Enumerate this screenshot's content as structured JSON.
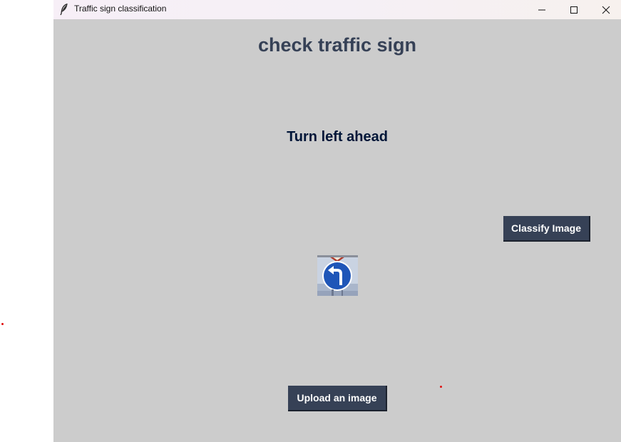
{
  "window": {
    "title": "Traffic sign classification",
    "icon": "feather-icon"
  },
  "titlebar_controls": {
    "minimize_icon": "minimize-icon",
    "maximize_icon": "maximize-icon",
    "close_icon": "close-icon"
  },
  "main": {
    "heading": "check traffic sign",
    "result_label": "Turn left ahead",
    "classify_button": "Classify Image",
    "upload_button": "Upload an image",
    "image": {
      "subject": "blue circular turn-left-ahead traffic sign"
    }
  },
  "colors": {
    "window_bg": "#cccccc",
    "heading_color": "#364156",
    "result_color": "#011638",
    "button_bg": "#364156",
    "button_text": "#ffffff",
    "sign_blue": "#1f56b8"
  }
}
